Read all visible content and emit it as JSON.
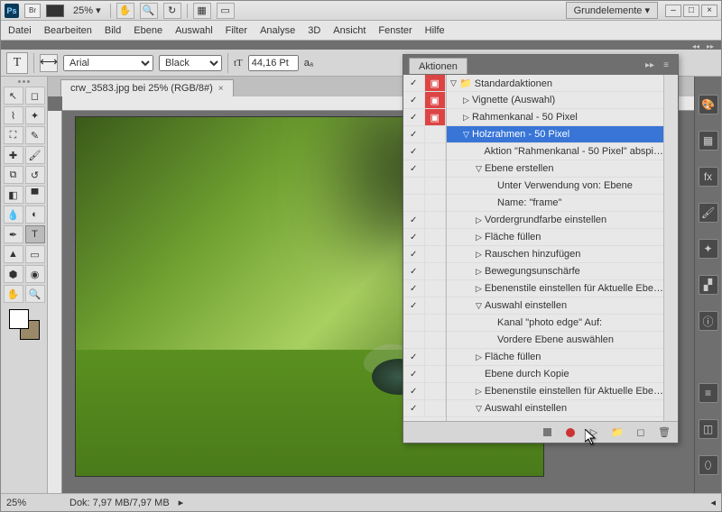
{
  "titlebar": {
    "zoom": "25%",
    "workspace": "Grundelemente"
  },
  "menu": [
    "Datei",
    "Bearbeiten",
    "Bild",
    "Ebene",
    "Auswahl",
    "Filter",
    "Analyse",
    "3D",
    "Ansicht",
    "Fenster",
    "Hilfe"
  ],
  "options": {
    "font": "Arial",
    "weight": "Black",
    "size": "44,16 Pt"
  },
  "doc": {
    "tab": "crw_3583.jpg bei 25% (RGB/8#)"
  },
  "status": {
    "zoom": "25%",
    "dok": "Dok: 7,97 MB/7,97 MB"
  },
  "actions": {
    "title": "Aktionen",
    "rows": [
      {
        "chk": true,
        "mod": "red",
        "ind": 0,
        "tw": "▽",
        "icon": "📁",
        "label": "Standardaktionen"
      },
      {
        "chk": true,
        "mod": "red",
        "ind": 1,
        "tw": "▷",
        "label": "Vignette (Auswahl)"
      },
      {
        "chk": true,
        "mod": "red",
        "ind": 1,
        "tw": "▷",
        "label": "Rahmenkanal - 50 Pixel"
      },
      {
        "chk": true,
        "mod": "",
        "ind": 1,
        "tw": "▽",
        "label": "Holzrahmen - 50 Pixel",
        "sel": true
      },
      {
        "chk": true,
        "mod": "",
        "ind": 2,
        "tw": "",
        "label": "Aktion \"Rahmenkanal - 50 Pixel\" abspi…"
      },
      {
        "chk": true,
        "mod": "",
        "ind": 2,
        "tw": "▽",
        "label": "Ebene erstellen"
      },
      {
        "chk": false,
        "mod": "",
        "ind": 3,
        "tw": "",
        "label": "Unter Verwendung von: Ebene"
      },
      {
        "chk": false,
        "mod": "",
        "ind": 3,
        "tw": "",
        "label": "Name:  \"frame\""
      },
      {
        "chk": true,
        "mod": "",
        "ind": 2,
        "tw": "▷",
        "label": "Vordergrundfarbe einstellen"
      },
      {
        "chk": true,
        "mod": "",
        "ind": 2,
        "tw": "▷",
        "label": "Fläche füllen"
      },
      {
        "chk": true,
        "mod": "",
        "ind": 2,
        "tw": "▷",
        "label": "Rauschen hinzufügen"
      },
      {
        "chk": true,
        "mod": "",
        "ind": 2,
        "tw": "▷",
        "label": "Bewegungsunschärfe"
      },
      {
        "chk": true,
        "mod": "",
        "ind": 2,
        "tw": "▷",
        "label": "Ebenenstile einstellen  für Aktuelle Ebe…"
      },
      {
        "chk": true,
        "mod": "",
        "ind": 2,
        "tw": "▽",
        "label": "Auswahl einstellen"
      },
      {
        "chk": false,
        "mod": "",
        "ind": 3,
        "tw": "",
        "label": "Kanal \"photo edge\" Auf:"
      },
      {
        "chk": false,
        "mod": "",
        "ind": 3,
        "tw": "",
        "label": "Vordere Ebene auswählen"
      },
      {
        "chk": true,
        "mod": "",
        "ind": 2,
        "tw": "▷",
        "label": "Fläche füllen"
      },
      {
        "chk": true,
        "mod": "",
        "ind": 2,
        "tw": "",
        "label": "Ebene durch Kopie"
      },
      {
        "chk": true,
        "mod": "",
        "ind": 2,
        "tw": "▷",
        "label": "Ebenenstile einstellen  für Aktuelle Ebe…"
      },
      {
        "chk": true,
        "mod": "",
        "ind": 2,
        "tw": "▽",
        "label": "Auswahl einstellen"
      }
    ]
  }
}
